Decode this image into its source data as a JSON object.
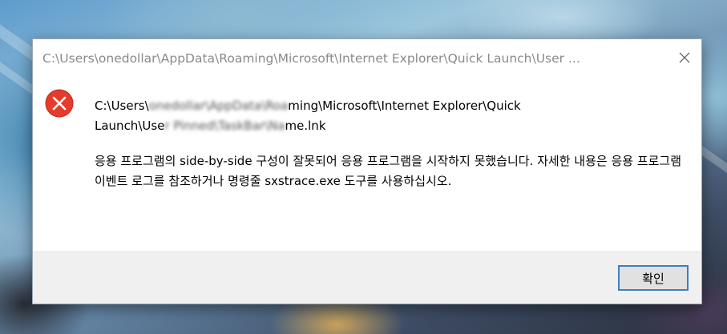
{
  "dialog": {
    "title": "C:\\Users\\onedollar\\AppData\\Roaming\\Microsoft\\Internet Explorer\\Quick Launch\\User ...",
    "close_icon": "close-icon",
    "error_icon": "error-icon",
    "error_color": "#e53b2c",
    "path_line1_prefix": "C:\\Users\\",
    "path_line1_blurred": "onedollar\\AppData\\Roa",
    "path_line1_suffix": "ming\\Microsoft\\Internet Explorer\\Quick",
    "path_line2_prefix": "Launch\\Use",
    "path_line2_blurred": "r Pinned\\TaskBar\\Na",
    "path_line2_suffix": "me.lnk",
    "message": "응용 프로그램의 side-by-side 구성이 잘못되어 응용 프로그램을 시작하지 못했습니다. 자세한 내용은 응용 프로그램 이벤트 로그를 참조하거나 명령줄 sxstrace.exe 도구를 사용하십시오.",
    "ok_label": "확인",
    "accent_color": "#3c7fc4"
  }
}
